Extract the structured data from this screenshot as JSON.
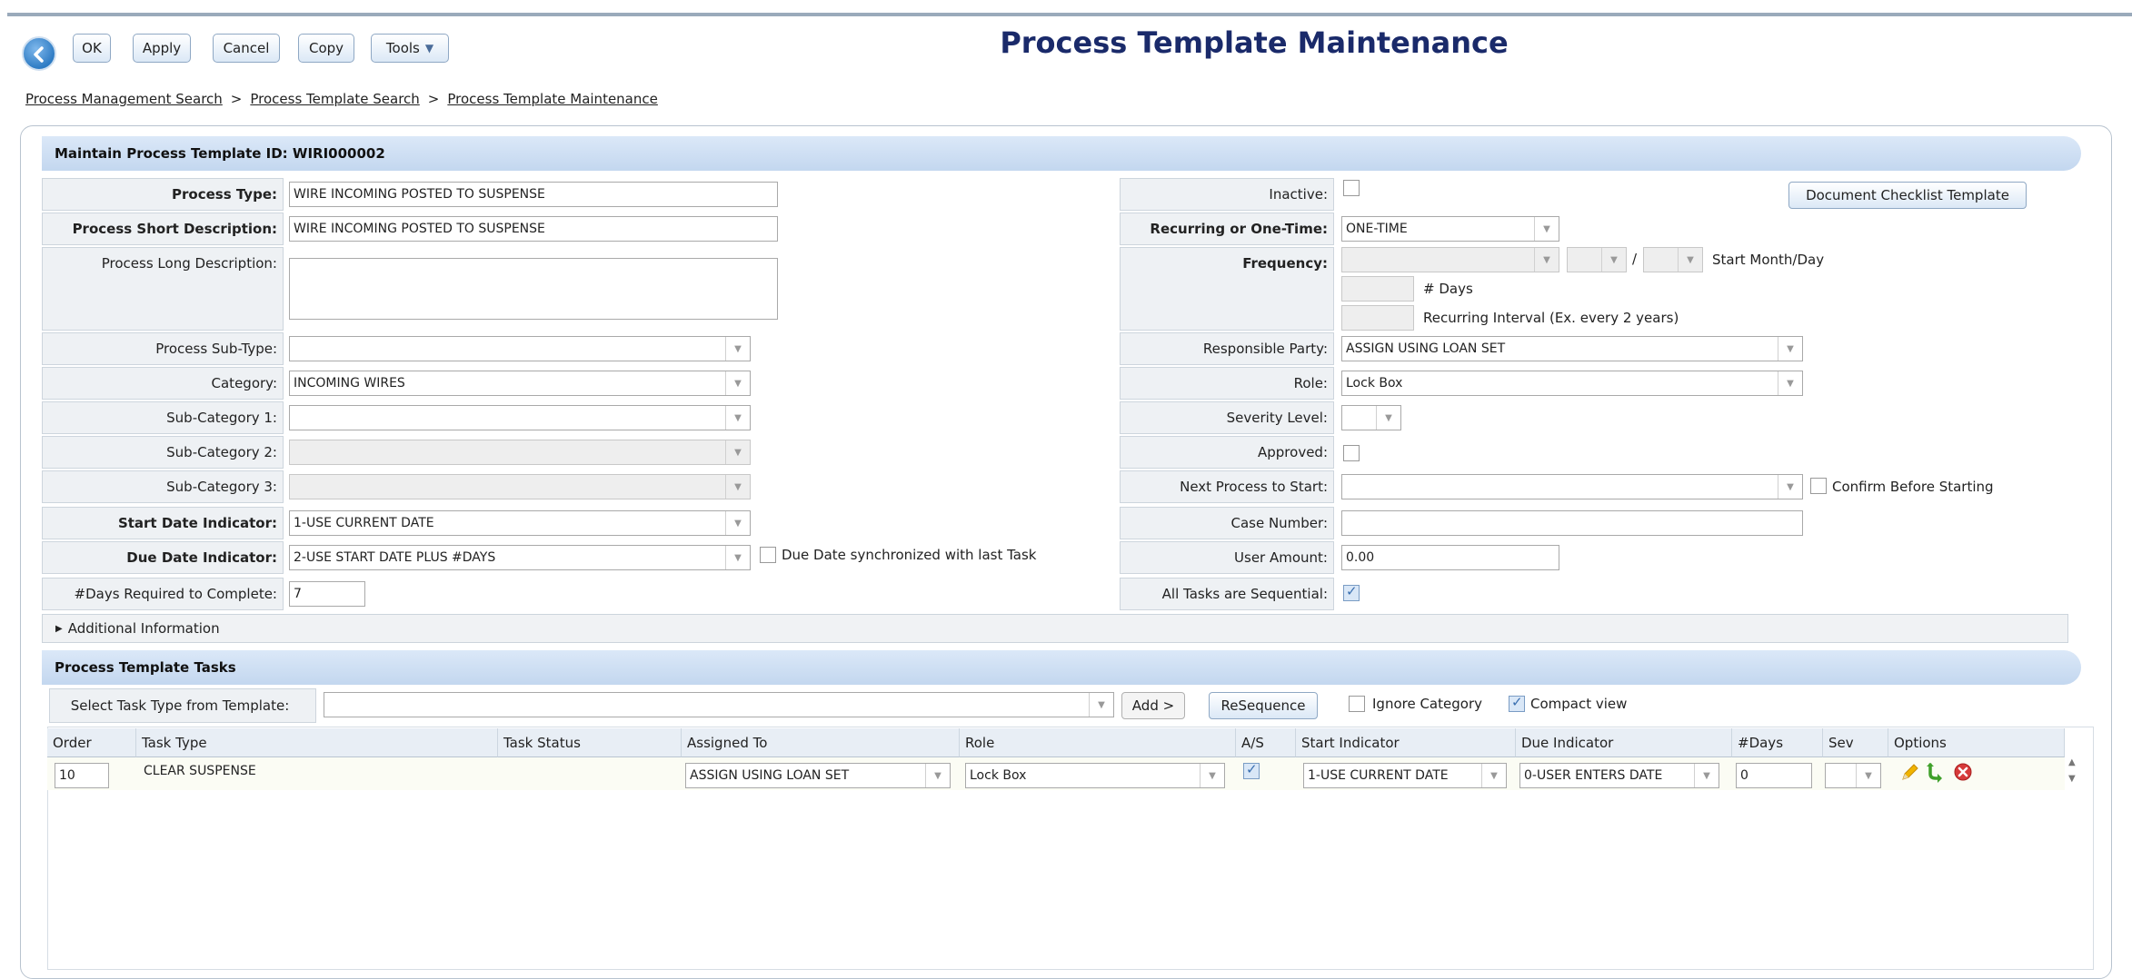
{
  "toolbar": {
    "ok": "OK",
    "apply": "Apply",
    "cancel": "Cancel",
    "copy": "Copy",
    "tools": "Tools"
  },
  "page_title": "Process Template Maintenance",
  "breadcrumb": [
    "Process Management Search",
    "Process Template Search",
    "Process Template Maintenance"
  ],
  "breadcrumb_sep": ">",
  "section_title": "Maintain Process Template ID: WIRI000002",
  "left": {
    "process_type": {
      "label": "Process Type:",
      "value": "WIRE INCOMING POSTED TO SUSPENSE"
    },
    "short_desc": {
      "label": "Process Short Description:",
      "value": "WIRE INCOMING POSTED TO SUSPENSE"
    },
    "long_desc": {
      "label": "Process Long Description:",
      "value": ""
    },
    "sub_type": {
      "label": "Process Sub-Type:",
      "value": ""
    },
    "category": {
      "label": "Category:",
      "value": "INCOMING WIRES"
    },
    "sub_cat1": {
      "label": "Sub-Category 1:",
      "value": ""
    },
    "sub_cat2": {
      "label": "Sub-Category 2:",
      "value": ""
    },
    "sub_cat3": {
      "label": "Sub-Category 3:",
      "value": ""
    },
    "start_ind": {
      "label": "Start Date Indicator:",
      "value": "1-USE CURRENT DATE"
    },
    "due_ind": {
      "label": "Due Date Indicator:",
      "value": "2-USE START DATE PLUS #DAYS"
    },
    "due_sync_label": "Due Date synchronized with last Task",
    "days_req": {
      "label": "#Days Required to Complete:",
      "value": "7"
    }
  },
  "right": {
    "inactive": {
      "label": "Inactive:"
    },
    "doc_checklist_button": "Document Checklist Template",
    "recurring": {
      "label": "Recurring or One-Time:",
      "value": "ONE-TIME"
    },
    "frequency": {
      "label": "Frequency:"
    },
    "slash": "/",
    "start_month_day": "Start Month/Day",
    "num_days": "# Days",
    "recurring_interval": "Recurring Interval  (Ex. every 2 years)",
    "responsible": {
      "label": "Responsible Party:",
      "value": "ASSIGN USING LOAN SET"
    },
    "role": {
      "label": "Role:",
      "value": "Lock Box"
    },
    "severity": {
      "label": "Severity Level:"
    },
    "approved": {
      "label": "Approved:"
    },
    "next_process": {
      "label": "Next Process to Start:",
      "value": ""
    },
    "confirm_label": "Confirm Before Starting",
    "case_number": {
      "label": "Case Number:",
      "value": ""
    },
    "user_amount": {
      "label": "User Amount:",
      "value": "0.00"
    },
    "all_seq": {
      "label": "All Tasks are Sequential:"
    }
  },
  "additional_info": "Additional Information",
  "tasks": {
    "title": "Process Template Tasks",
    "select_label": "Select Task Type from Template:",
    "add_button": "Add >",
    "resequence_button": "ReSequence",
    "ignore_category": "Ignore Category",
    "compact_view": "Compact view",
    "columns": [
      "Order",
      "Task Type",
      "Task Status",
      "Assigned To",
      "Role",
      "A/S",
      "Start Indicator",
      "Due Indicator",
      "#Days",
      "Sev",
      "Options"
    ],
    "rows": [
      {
        "order": "10",
        "task_type": "CLEAR SUSPENSE",
        "task_status": "",
        "assigned_to": "ASSIGN USING LOAN SET",
        "role": "Lock Box",
        "as_checked": true,
        "start_indicator": "1-USE CURRENT DATE",
        "due_indicator": "0-USER ENTERS DATE",
        "days": "0",
        "sev": ""
      }
    ]
  },
  "colors": {
    "title": "#1a2a6a",
    "band": "#c3d7ef",
    "label_bg": "#eef1f4"
  }
}
